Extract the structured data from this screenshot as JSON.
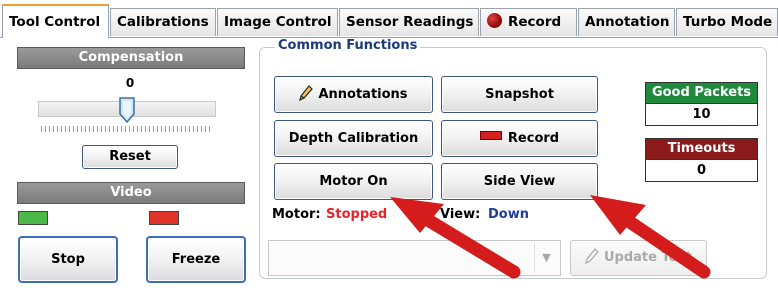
{
  "tabs": [
    {
      "label": "Tool Control",
      "active": true
    },
    {
      "label": "Calibrations"
    },
    {
      "label": "Image Control"
    },
    {
      "label": "Sensor Readings"
    },
    {
      "label": "Record"
    },
    {
      "label": "Annotation"
    },
    {
      "label": "Turbo Mode"
    }
  ],
  "compensation": {
    "title": "Compensation",
    "value": "0",
    "reset_label": "Reset"
  },
  "video": {
    "title": "Video",
    "stop_label": "Stop",
    "freeze_label": "Freeze",
    "indicator_left_color": "#4cb847",
    "indicator_right_color": "#e0342b"
  },
  "common": {
    "title": "Common Functions",
    "annotations_label": "Annotations",
    "snapshot_label": "Snapshot",
    "depth_calibration_label": "Depth Calibration",
    "record_label": "Record",
    "motor_on_label": "Motor On",
    "side_view_label": "Side View",
    "motor_label": "Motor:",
    "motor_status": "Stopped",
    "view_label": "View:",
    "view_status": "Down",
    "dropdown_value": "",
    "update_text_label": "Update Text"
  },
  "stats": {
    "good_packets_label": "Good Packets",
    "good_packets_value": "10",
    "timeouts_label": "Timeouts",
    "timeouts_value": "0"
  },
  "colors": {
    "good_packets_bg": "#1e8a3c",
    "timeouts_bg": "#8b1a1a",
    "motor_status": "#e8222a",
    "view_status": "#1f3d99",
    "arrow": "#d41c1c",
    "tab_accent": "#f0a030"
  },
  "icons": {
    "annotations": "pencil-icon",
    "record": "record-bar-icon",
    "update_text": "pencil-icon",
    "record_tab": "record-dot-icon",
    "dropdown": "chevron-down-icon"
  },
  "slider": {
    "value": 0
  }
}
